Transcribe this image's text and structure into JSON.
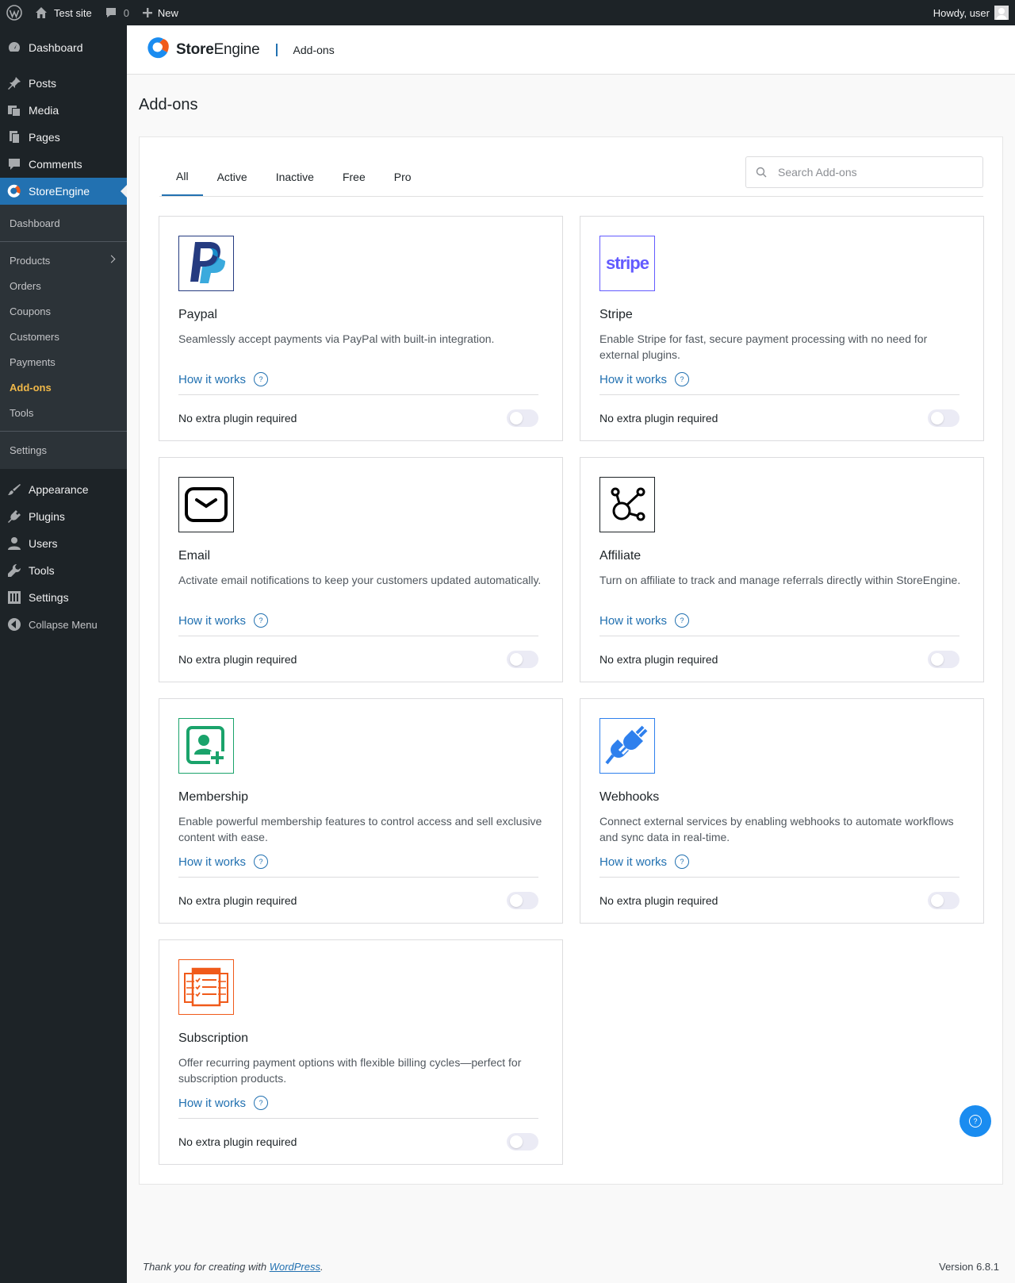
{
  "adminbar": {
    "site_name": "Test site",
    "comments_count": "0",
    "new_label": "New",
    "howdy": "Howdy, user"
  },
  "sidebar": {
    "top_items": [
      {
        "label": "Dashboard",
        "icon": "dashboard-icon"
      },
      {
        "label": "Posts",
        "icon": "pin-icon"
      },
      {
        "label": "Media",
        "icon": "media-icon"
      },
      {
        "label": "Pages",
        "icon": "pages-icon"
      },
      {
        "label": "Comments",
        "icon": "comment-icon"
      },
      {
        "label": "StoreEngine",
        "icon": "storeengine-icon"
      }
    ],
    "submenu": [
      "Dashboard",
      "Products",
      "Orders",
      "Coupons",
      "Customers",
      "Payments",
      "Add-ons",
      "Tools",
      "Settings"
    ],
    "bottom_items": [
      {
        "label": "Appearance",
        "icon": "brush-icon"
      },
      {
        "label": "Plugins",
        "icon": "plugin-icon"
      },
      {
        "label": "Users",
        "icon": "user-icon"
      },
      {
        "label": "Tools",
        "icon": "wrench-icon"
      },
      {
        "label": "Settings",
        "icon": "settings-icon"
      },
      {
        "label": "Collapse Menu",
        "icon": "collapse-icon"
      }
    ]
  },
  "header": {
    "brand_bold": "Store",
    "brand_light": "Engine",
    "section": "Add-ons"
  },
  "page_title": "Add-ons",
  "tabs": [
    "All",
    "Active",
    "Inactive",
    "Free",
    "Pro"
  ],
  "search": {
    "placeholder": "Search Add-ons"
  },
  "how_label": "How it works",
  "addons": [
    {
      "title": "Paypal",
      "desc": "Seamlessly accept payments via PayPal with built-in integration.",
      "req": "No extra plugin required",
      "enabled": false,
      "icon": "paypal-icon",
      "color": "#253b80"
    },
    {
      "title": "Stripe",
      "desc": "Enable Stripe for fast, secure payment processing with no need for external plugins.",
      "req": "No extra plugin required",
      "enabled": false,
      "icon": "stripe-icon",
      "color": "#635bff",
      "icon_text": "stripe"
    },
    {
      "title": "Email",
      "desc": "Activate email notifications to keep your customers updated automatically.",
      "req": "No extra plugin required",
      "enabled": false,
      "icon": "email-icon",
      "color": "#1d2327"
    },
    {
      "title": "Affiliate",
      "desc": "Turn on affiliate to track and manage referrals directly within StoreEngine.",
      "req": "No extra plugin required",
      "enabled": false,
      "icon": "affiliate-icon",
      "color": "#1d2327"
    },
    {
      "title": "Membership",
      "desc": "Enable powerful membership features to control access and sell exclusive content with ease.",
      "req": "No extra plugin required",
      "enabled": false,
      "icon": "membership-icon",
      "color": "#1aa36b"
    },
    {
      "title": "Webhooks",
      "desc": "Connect external services by enabling webhooks to automate workflows and sync data in real-time.",
      "req": "No extra plugin required",
      "enabled": false,
      "icon": "webhooks-icon",
      "color": "#2f80ed"
    },
    {
      "title": "Subscription",
      "desc": "Offer recurring payment options with flexible billing cycles—perfect for subscription products.",
      "req": "No extra plugin required",
      "enabled": false,
      "icon": "subscription-icon",
      "color": "#f05a1a"
    }
  ],
  "footer": {
    "thanks_prefix": "Thank you for creating with ",
    "link": "WordPress",
    "suffix": ".",
    "version": "Version 6.8.1"
  },
  "colors": {
    "accent": "#2271b1",
    "sidebar_bg": "#1d2327",
    "active_sub": "#f0b849"
  }
}
